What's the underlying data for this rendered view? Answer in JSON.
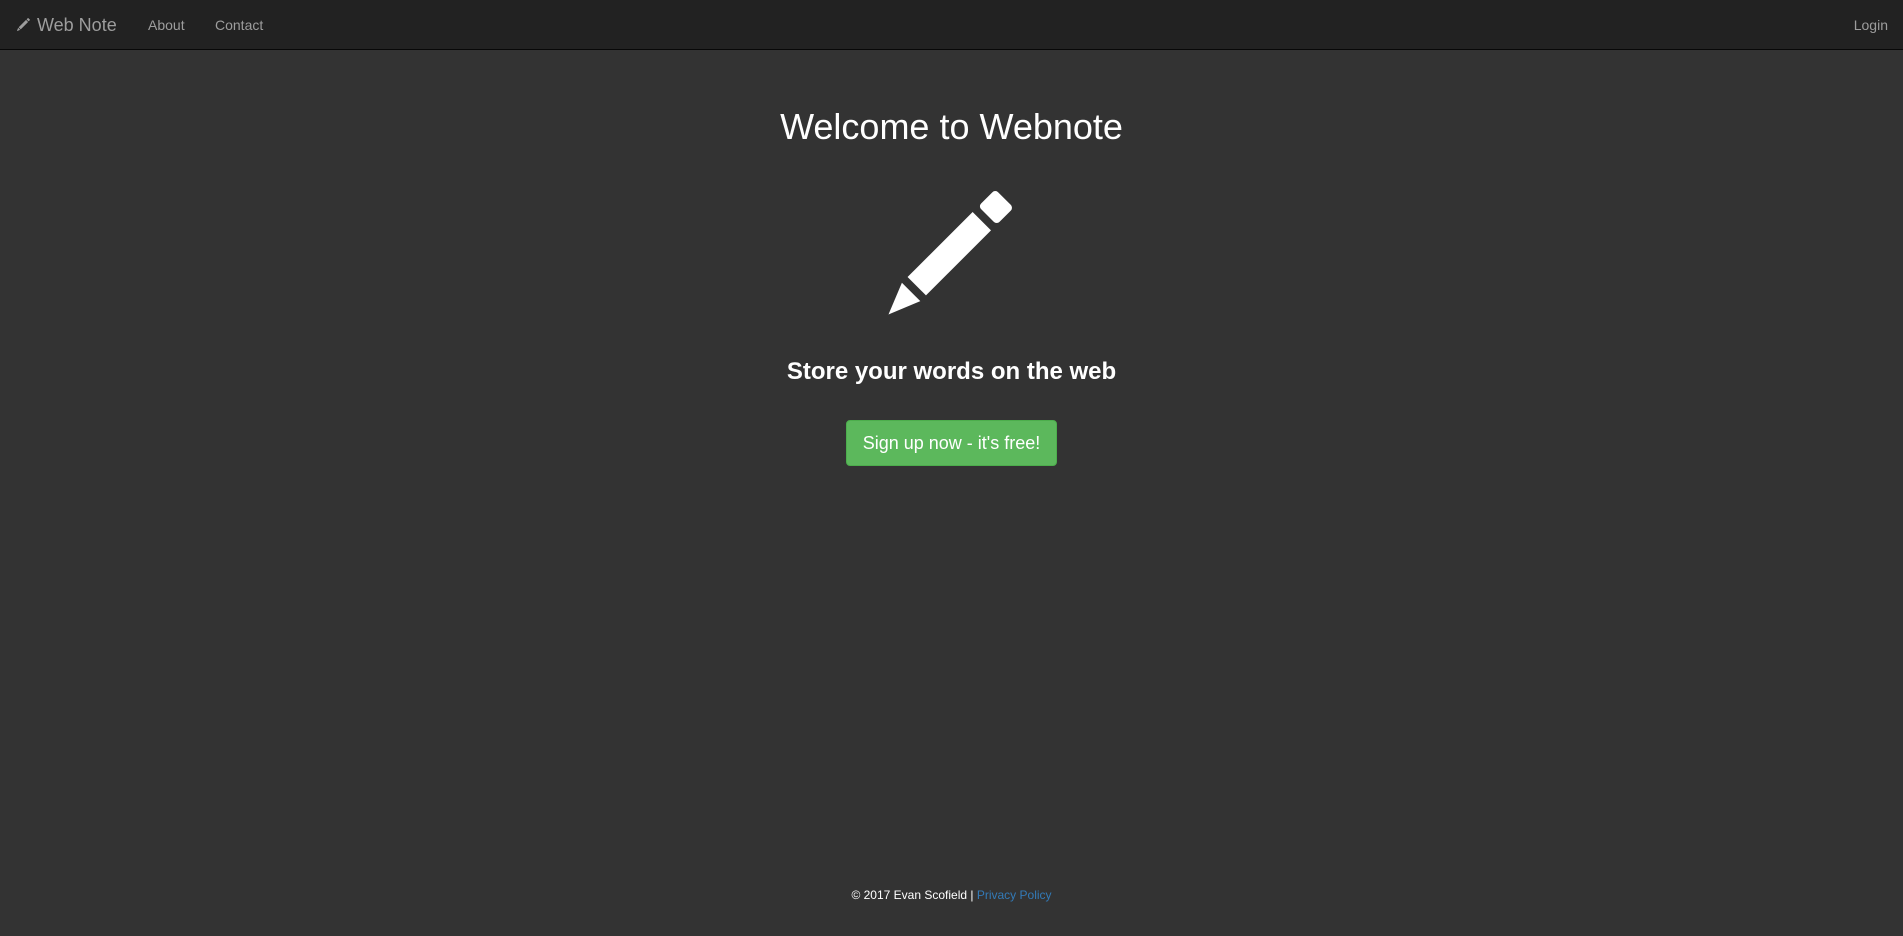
{
  "navbar": {
    "brand_label": "Web Note",
    "brand_icon": "pencil-icon",
    "links": {
      "about": "About",
      "contact": "Contact",
      "login": "Login"
    }
  },
  "hero": {
    "title": "Welcome to Webnote",
    "icon": "pencil-icon",
    "subtitle": "Store your words on the web",
    "cta_label": "Sign up now - it's free!"
  },
  "footer": {
    "copyright": "© 2017 Evan Scofield |",
    "privacy_link": "Privacy Policy"
  },
  "colors": {
    "background": "#333333",
    "navbar": "#222222",
    "cta": "#5cb85c",
    "link": "#337ab7"
  }
}
